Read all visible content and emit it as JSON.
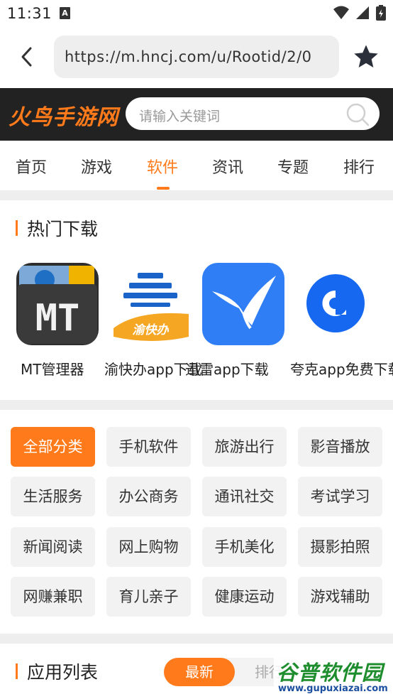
{
  "status_bar": {
    "time": "11:31",
    "notification_glyph": "A"
  },
  "browser": {
    "url": "https://m.hncj.com/u/Rootid/2/0"
  },
  "site": {
    "logo": "火鸟手游网",
    "search_placeholder": "请输入关键词"
  },
  "nav": {
    "tabs": [
      {
        "label": "首页"
      },
      {
        "label": "游戏"
      },
      {
        "label": "软件"
      },
      {
        "label": "资讯"
      },
      {
        "label": "专题"
      },
      {
        "label": "排行"
      }
    ],
    "active_index": 2
  },
  "hot": {
    "title": "热门下载",
    "items": [
      {
        "name": "MT管理器",
        "icon": "mt-manager-icon"
      },
      {
        "name": "渝快办app下载",
        "icon": "yukuaiban-icon"
      },
      {
        "name": "迅雷app下载",
        "icon": "xunlei-icon"
      },
      {
        "name": "夸克app免费下载",
        "icon": "quark-icon"
      }
    ]
  },
  "categories": [
    "全部分类",
    "手机软件",
    "旅游出行",
    "影音播放",
    "生活服务",
    "办公商务",
    "通讯社交",
    "考试学习",
    "新闻阅读",
    "网上购物",
    "手机美化",
    "摄影拍照",
    "网赚兼职",
    "育儿亲子",
    "健康运动",
    "游戏辅助"
  ],
  "app_list": {
    "title": "应用列表",
    "tab_new": "最新",
    "tab_rank": "排行"
  },
  "watermark": {
    "name": "谷普软件园",
    "url": "www.gupuxiazai.com"
  },
  "colors": {
    "accent": "#ff7a1a",
    "header_bg": "#222222",
    "divider": "#eeeeee"
  }
}
